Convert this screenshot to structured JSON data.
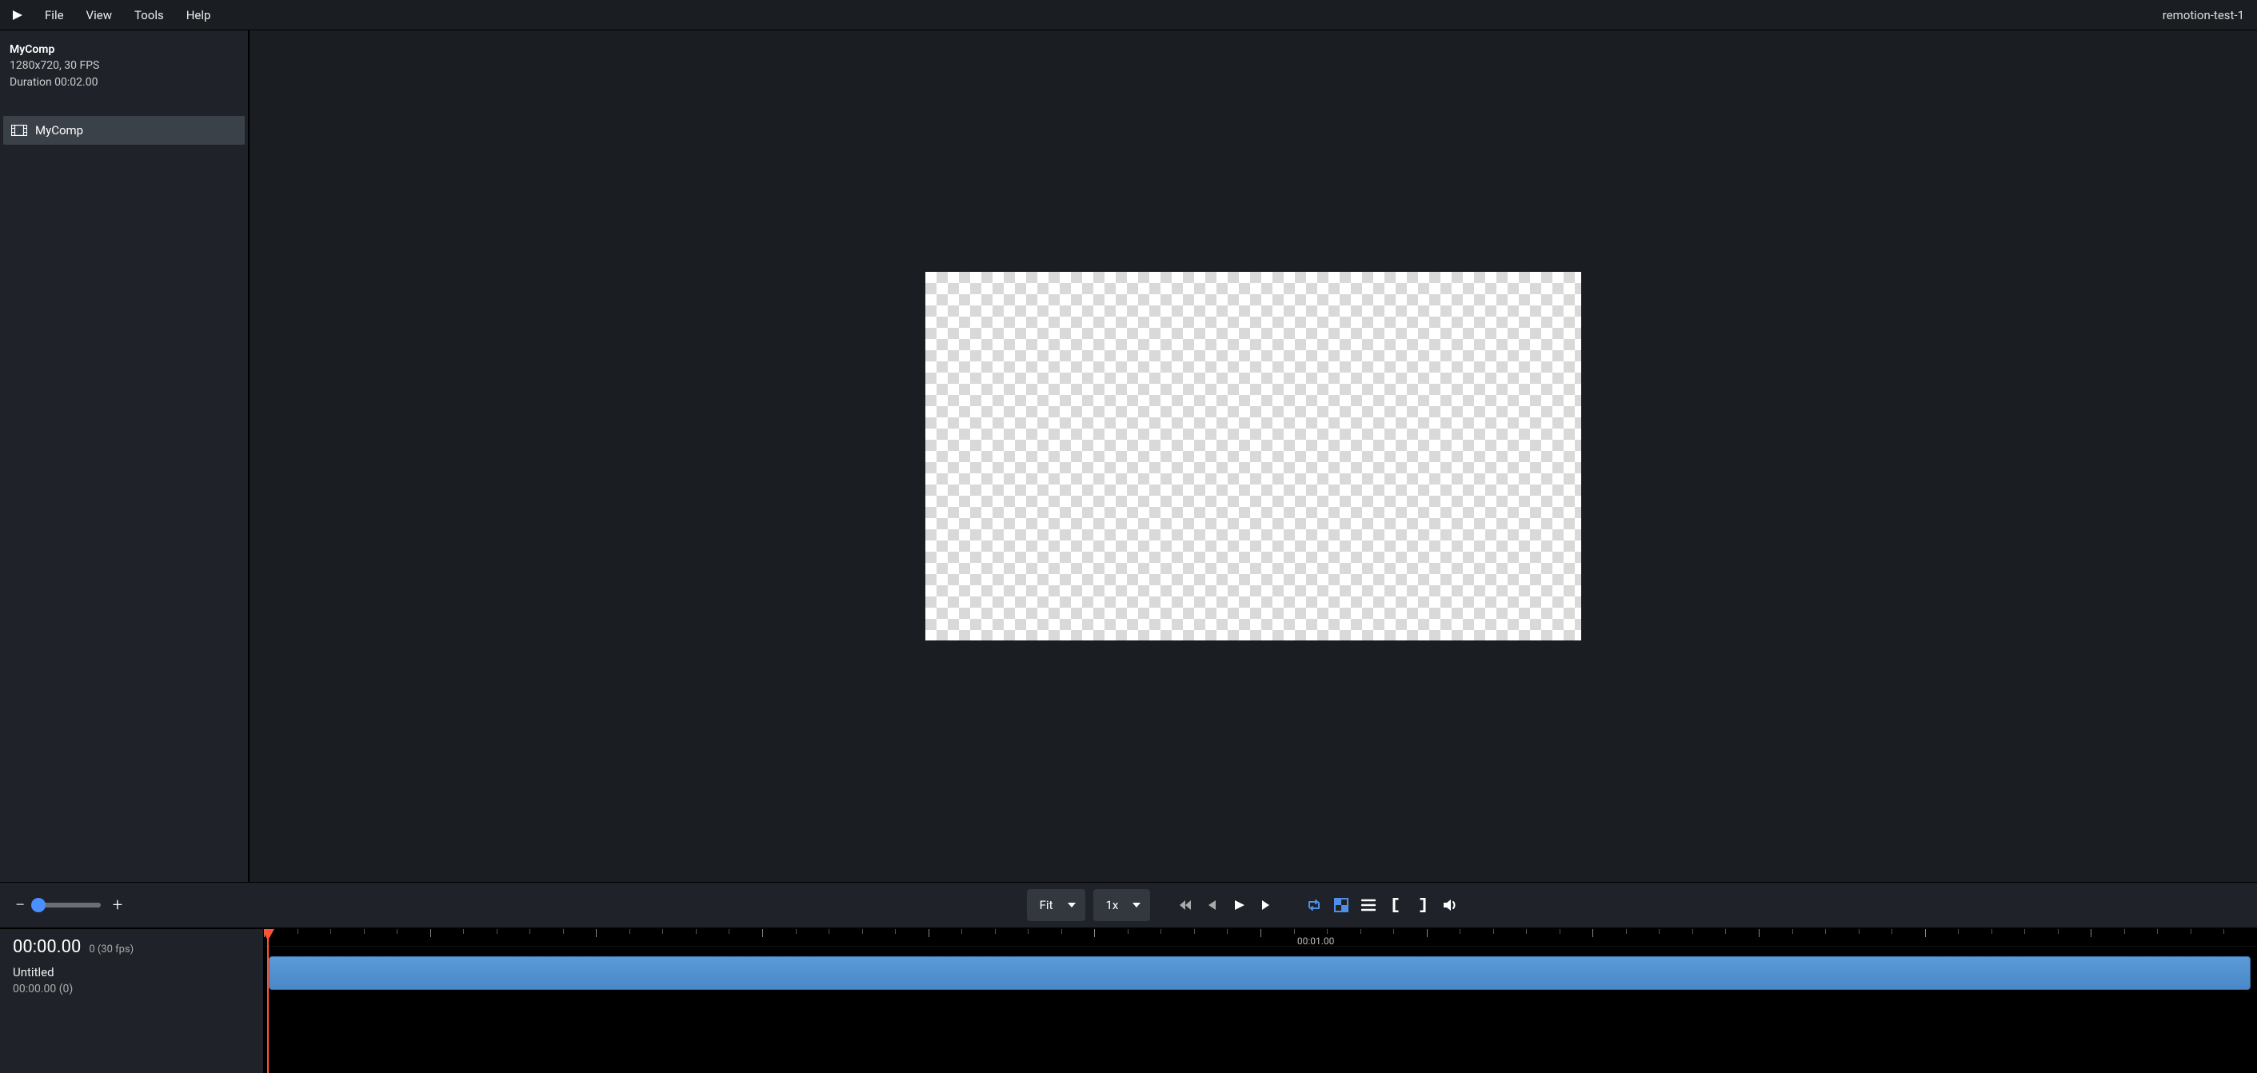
{
  "menubar": {
    "items": [
      "File",
      "View",
      "Tools",
      "Help"
    ],
    "project_name": "remotion-test-1"
  },
  "sidebar": {
    "composition": {
      "name": "MyComp",
      "specs": "1280x720, 30 FPS",
      "duration": "Duration 00:02.00"
    },
    "items": [
      {
        "label": "MyComp"
      }
    ]
  },
  "controlbar": {
    "fit_label": "Fit",
    "speed_label": "1x"
  },
  "timeline": {
    "current_time": "00:00.00",
    "fps_label": "0 (30 fps)",
    "track_name": "Untitled",
    "track_subtime": "00:00.00 (0)",
    "markers": [
      {
        "pos_pct": 52,
        "label": "00:01.00"
      }
    ]
  }
}
